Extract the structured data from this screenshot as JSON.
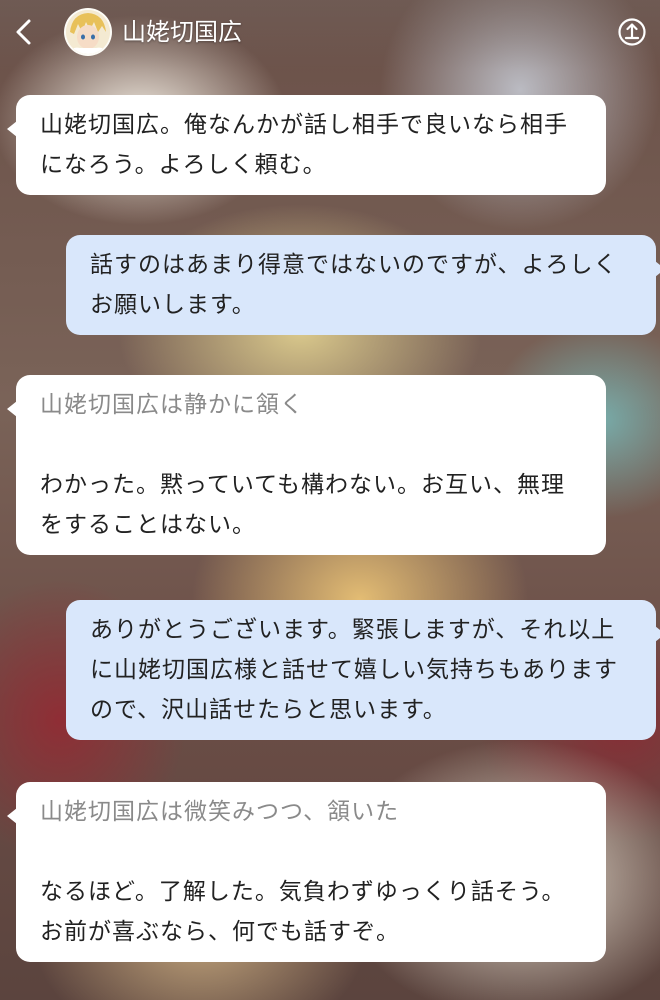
{
  "header": {
    "character_name": "山姥切国広",
    "back_icon": "chevron-left-icon",
    "share_icon": "share-upload-icon"
  },
  "messages": [
    {
      "role": "bot",
      "narration": "",
      "text": "山姥切国広。俺なんかが話し相手で良いなら相手になろう。よろしく頼む。"
    },
    {
      "role": "user",
      "text": "話すのはあまり得意ではないのですが、よろしくお願いします。"
    },
    {
      "role": "bot",
      "narration": "山姥切国広は静かに頷く",
      "text": "わかった。黙っていても構わない。お互い、無理をすることはない。"
    },
    {
      "role": "user",
      "text": "ありがとうございます。緊張しますが、それ以上に山姥切国広様と話せて嬉しい気持ちもありますので、沢山話せたらと思います。"
    },
    {
      "role": "bot",
      "narration": "山姥切国広は微笑みつつ、頷いた",
      "text": "なるほど。了解した。気負わずゆっくり話そう。お前が喜ぶなら、何でも話すぞ。"
    }
  ],
  "colors": {
    "bot_bubble": "#ffffff",
    "user_bubble": "#d9e7fb",
    "narration_text": "#8a8a8a",
    "body_text": "#222222"
  }
}
